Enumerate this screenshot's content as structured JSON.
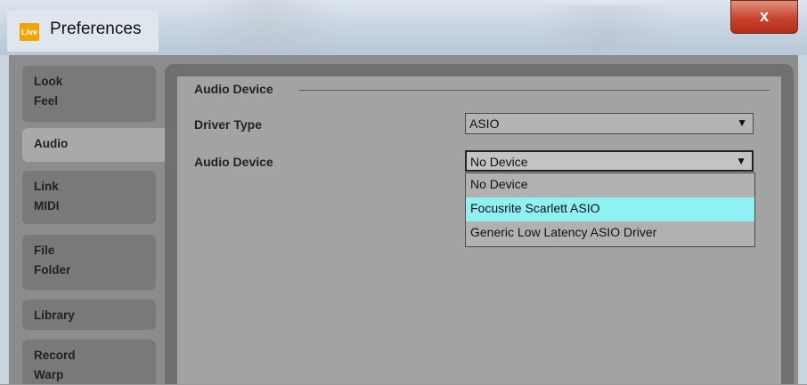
{
  "window": {
    "app_icon_text": "Live",
    "title": "Preferences",
    "close_label": "x"
  },
  "tabs": [
    {
      "line1": "Look",
      "line2": "Feel"
    },
    {
      "line1": "Audio",
      "line2": ""
    },
    {
      "line1": "Link",
      "line2": "MIDI"
    },
    {
      "line1": "File",
      "line2": "Folder"
    },
    {
      "line1": "Library",
      "line2": ""
    },
    {
      "line1": "Record",
      "line2": "Warp"
    }
  ],
  "active_tab": "Audio",
  "audio": {
    "section_title": "Audio Device",
    "driver_type_label": "Driver Type",
    "driver_type_value": "ASIO",
    "audio_device_label": "Audio Device",
    "audio_device_value": "No Device",
    "dropdown_options": [
      "No Device",
      "Focusrite Scarlett ASIO",
      "Generic Low Latency ASIO Driver"
    ],
    "highlighted_option": "Focusrite Scarlett ASIO",
    "arrow_icon": "▼"
  },
  "colors": {
    "highlight": "#8ff1f2",
    "close_button": "#c8432f",
    "app_icon": "#f2a400"
  }
}
